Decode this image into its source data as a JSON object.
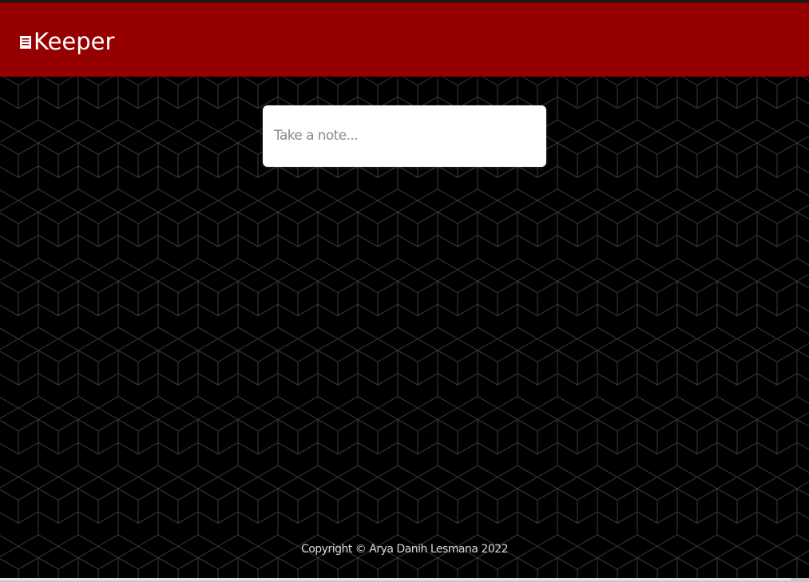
{
  "header": {
    "brand_title": "Keeper",
    "brand_icon": "note-icon",
    "background_color": "#960000"
  },
  "note_form": {
    "input_value": "",
    "input_placeholder": "Take a note..."
  },
  "footer": {
    "copyright_text": "Copyright © Arya Danih Lesmana 2022"
  },
  "theme": {
    "page_background": "#000000",
    "pattern_line_color": "#3a3a3a"
  }
}
